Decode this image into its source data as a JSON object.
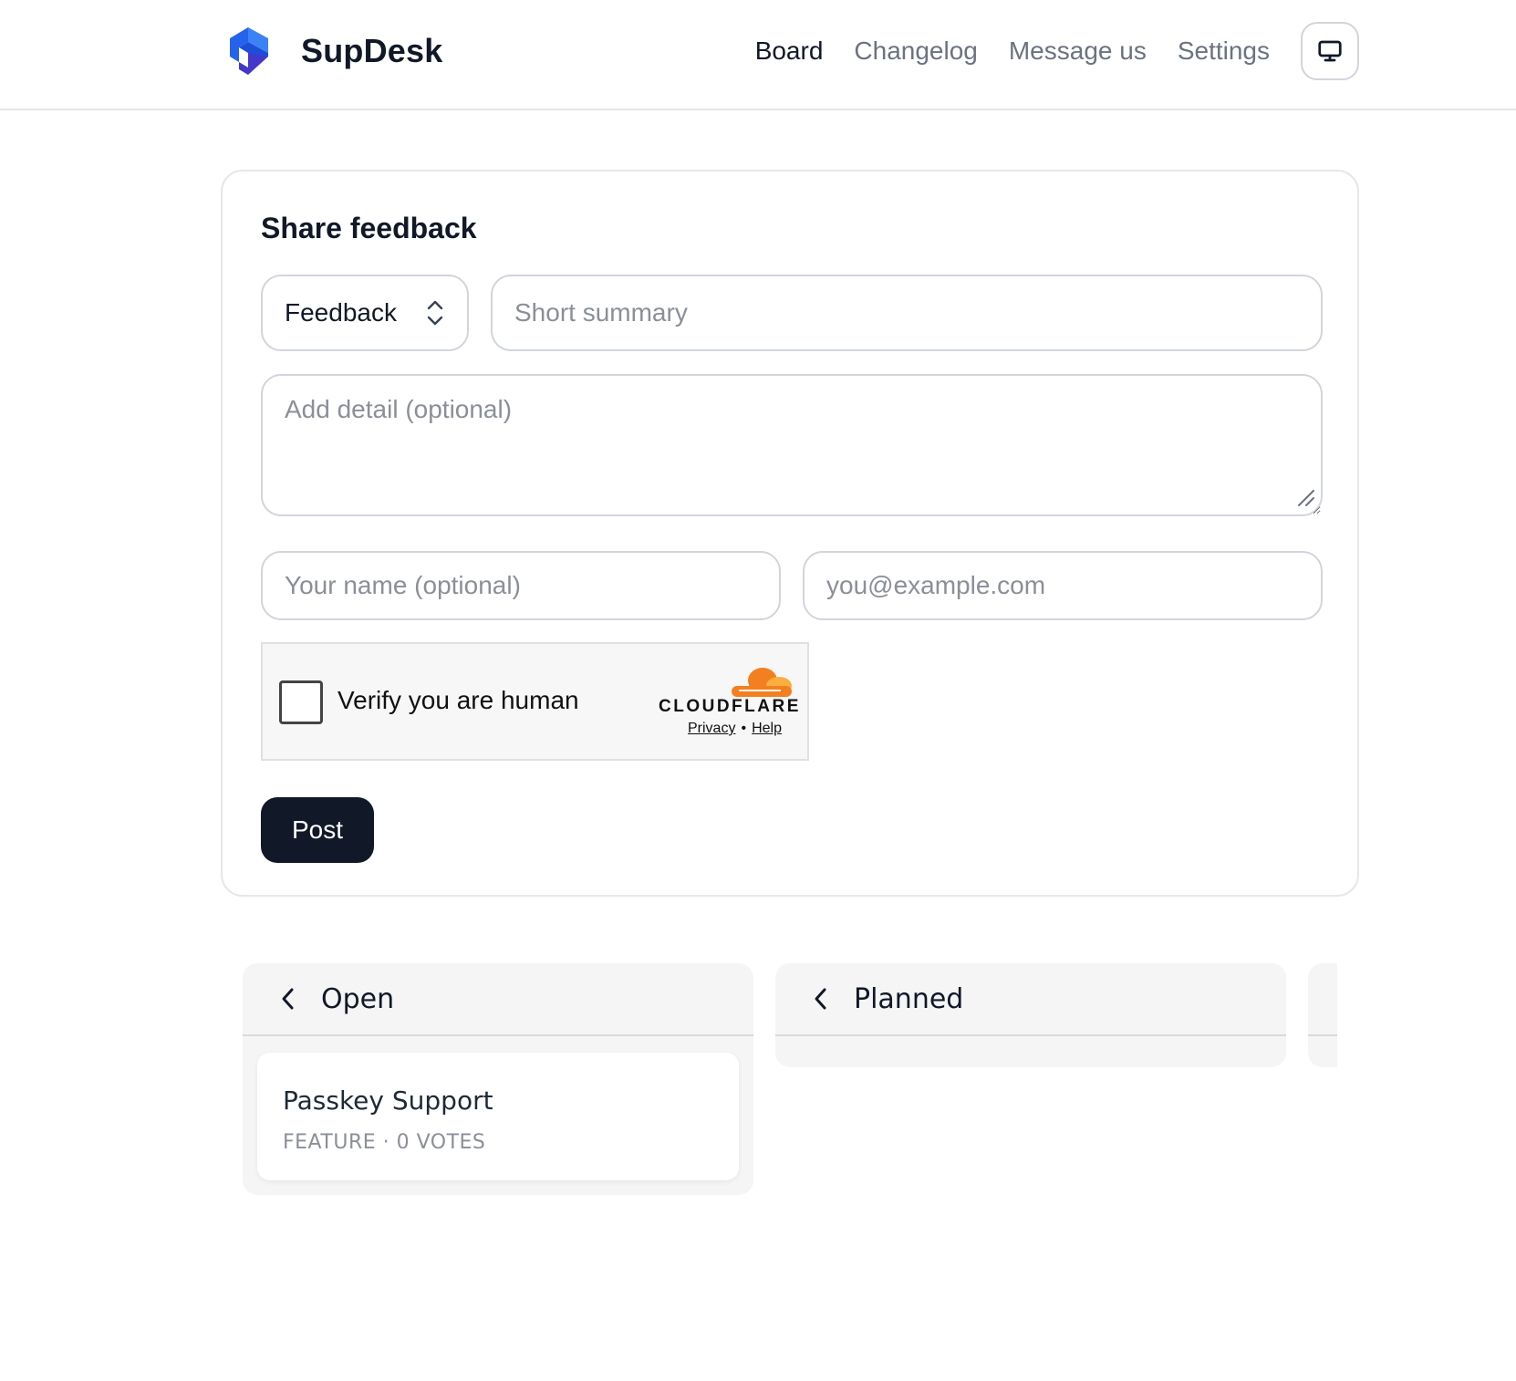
{
  "header": {
    "brand": "SupDesk",
    "nav": [
      {
        "label": "Board",
        "active": true
      },
      {
        "label": "Changelog",
        "active": false
      },
      {
        "label": "Message us",
        "active": false
      },
      {
        "label": "Settings",
        "active": false
      }
    ],
    "theme_icon": "monitor-icon"
  },
  "form": {
    "title": "Share feedback",
    "type_value": "Feedback",
    "summary_placeholder": "Short summary",
    "detail_placeholder": "Add detail (optional)",
    "name_placeholder": "Your name (optional)",
    "email_placeholder": "you@example.com",
    "captcha": {
      "label": "Verify you are human",
      "brand": "CLOUDFLARE",
      "privacy": "Privacy",
      "separator": "•",
      "help": "Help"
    },
    "submit_label": "Post"
  },
  "board": {
    "columns": [
      {
        "title": "Open",
        "posts": [
          {
            "title": "Passkey Support",
            "meta": "FEATURE · 0 VOTES"
          }
        ]
      },
      {
        "title": "Planned",
        "posts": []
      }
    ]
  },
  "colors": {
    "brand_blue": "#2563eb",
    "primary_dark": "#111827",
    "cloudflare_orange": "#f38020"
  }
}
